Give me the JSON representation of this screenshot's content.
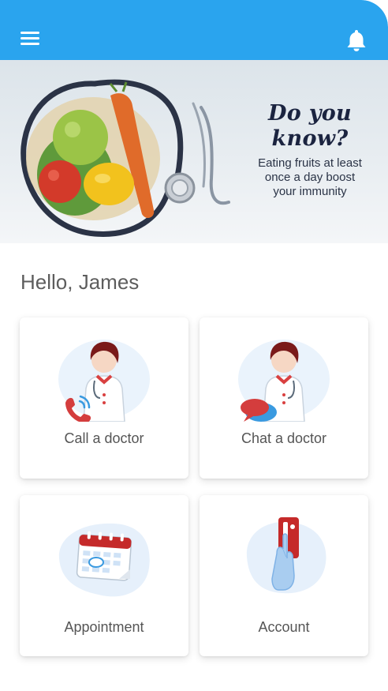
{
  "header": {
    "menu_icon": "hamburger-menu-icon",
    "notification_icon": "bell-icon",
    "accent_color": "#2aa4ee"
  },
  "banner": {
    "title": "Do you know?",
    "body_line1": "Eating fruits at least",
    "body_line2": "once a day boost",
    "body_line3": "your immunity"
  },
  "greeting": "Hello, James",
  "cards": [
    {
      "label": "Call a doctor",
      "icon": "doctor-phone-icon"
    },
    {
      "label": "Chat a doctor",
      "icon": "doctor-chat-icon"
    },
    {
      "label": "Appointment",
      "icon": "calendar-icon"
    },
    {
      "label": "Account",
      "icon": "account-card-icon"
    }
  ]
}
